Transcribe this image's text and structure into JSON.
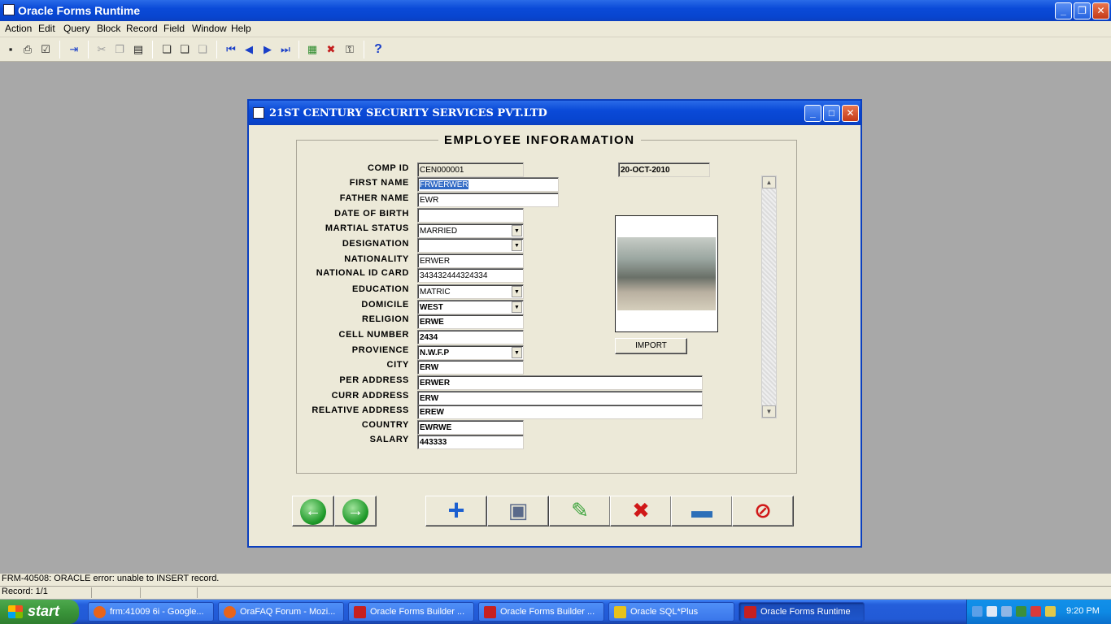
{
  "app": {
    "title": "Oracle Forms Runtime"
  },
  "menu": [
    "Action",
    "Edit",
    "Query",
    "Block",
    "Record",
    "Field",
    "Window",
    "Help"
  ],
  "toolbar": {
    "icons": [
      "save-icon",
      "print-icon",
      "print-preview-icon",
      "exit-icon",
      "cut-icon",
      "copy-icon",
      "paste-icon",
      "enter-query-icon",
      "execute-query-icon",
      "cancel-query-icon",
      "first-record-icon",
      "previous-record-icon",
      "next-record-icon",
      "last-record-icon",
      "insert-record-icon",
      "remove-record-icon",
      "lock-record-icon",
      "help-icon"
    ]
  },
  "window": {
    "title": "21ST CENTURY SECURITY SERVICES PVT.LTD"
  },
  "form": {
    "heading": "EMPLOYEE INFORAMATION",
    "date": "20-OCT-2010",
    "labels": {
      "comp_id": "COMP ID",
      "first_name": "FIRST NAME",
      "father_name": "FATHER NAME",
      "dob": "DATE OF BIRTH",
      "marital": "MARTIAL STATUS",
      "designation": "DESIGNATION",
      "nationality": "NATIONALITY",
      "nic": "NATIONAL ID CARD",
      "education": "EDUCATION",
      "domicile": "DOMICILE",
      "religion": "RELIGION",
      "cell": "CELL NUMBER",
      "province": "PROVIENCE",
      "city": "CITY",
      "per_address": "PER ADDRESS",
      "curr_address": "CURR ADDRESS",
      "relative_address": "RELATIVE ADDRESS",
      "country": "COUNTRY",
      "salary": "SALARY"
    },
    "values": {
      "comp_id": "CEN000001",
      "first_name": "FRWERWER",
      "father_name": "EWR",
      "dob": "",
      "marital": "MARRIED",
      "designation": "",
      "nationality": "ERWER",
      "nic": "343432444324334",
      "education": "MATRIC",
      "domicile": "WEST",
      "religion": "ERWE",
      "cell": "2434",
      "province": "N.W.F.P",
      "city": "ERW",
      "per_address": "ERWER",
      "curr_address": "ERW",
      "relative_address": "EREW",
      "country": "EWRWE",
      "salary": "443333"
    },
    "import_label": "IMPORT"
  },
  "status": {
    "message": "FRM-40508: ORACLE error: unable to INSERT record.",
    "record": "Record: 1/1"
  },
  "taskbar": {
    "start": "start",
    "tasks": [
      {
        "label": "frm:41009 6i - Google...",
        "color": "#e8641b"
      },
      {
        "label": "OraFAQ Forum - Mozi...",
        "color": "#e8641b"
      },
      {
        "label": "Oracle Forms Builder ...",
        "color": "#c62020"
      },
      {
        "label": "Oracle Forms Builder ...",
        "color": "#c62020"
      },
      {
        "label": "Oracle SQL*Plus",
        "color": "#e8c21b"
      },
      {
        "label": "Oracle Forms Runtime",
        "color": "#c62020"
      }
    ],
    "clock": "9:20 PM"
  }
}
